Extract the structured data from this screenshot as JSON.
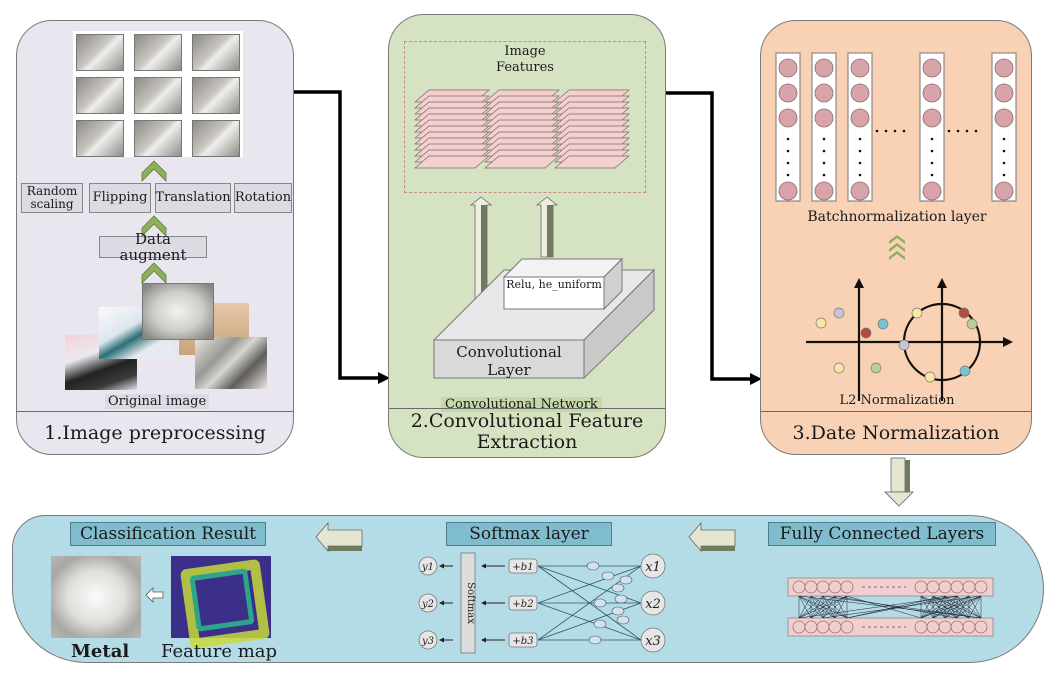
{
  "panels": {
    "preprocessing": {
      "footer": "1.Image preprocessing",
      "augment_ops": [
        "Random scaling",
        "Flipping",
        "Translation",
        "Rotation"
      ],
      "data_augment_label": "Data augment",
      "original_image_label": "Original image",
      "thumbnail_count": 9
    },
    "feature_extraction": {
      "footer": "2.Convolutional Feature Extraction",
      "image_features_label": "Image Features",
      "relu_label": "Relu, he_uniform",
      "conv_layer_label": "Convolutional Layer",
      "network_label": "Convolutional Network",
      "feature_stacks": 3
    },
    "normalization": {
      "footer": "3.Date Normalization",
      "batchnorm_label": "Batchnormalization layer",
      "l2_label": "L2 Normalization",
      "ellipsis": "· · · ·"
    }
  },
  "bottom": {
    "classification_title": "Classification Result",
    "class_label": "Metal",
    "feature_map_label": "Feature map",
    "softmax_title": "Softmax layer",
    "softmax_box_label": "Softmax",
    "outputs": [
      "y1",
      "y2",
      "y3"
    ],
    "biases": [
      "+b1",
      "+b2",
      "+b3"
    ],
    "inputs": [
      "x1",
      "x2",
      "x3"
    ],
    "fc_title": "Fully Connected Layers",
    "fc_dashes": "------"
  },
  "colors": {
    "panel1_bg": "#e9e6ef",
    "panel2_bg": "#d6e3c3",
    "panel3_bg": "#f9d2b5",
    "bottom_bg": "#b3dce6",
    "title_box": "#7fbccd",
    "chevron_green": "#8db05a",
    "neuron_pink": "#d9a4a9"
  }
}
